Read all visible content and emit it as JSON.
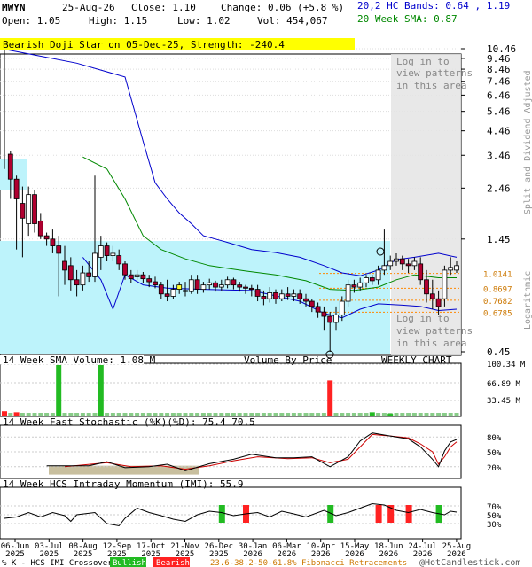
{
  "header": {
    "ticker": "MWYN",
    "date": "25-Aug-26",
    "close": "Close: 1.10",
    "change": "Change: 0.06 (+5.8 %)",
    "open": "Open: 1.05",
    "high": "High: 1.15",
    "low": "Low: 1.02",
    "vol": "Vol: 454,067",
    "hc_bands": "20,2 HC Bands: 0.64 , 1.19",
    "sma20": "20 Week SMA: 0.87"
  },
  "banner": "Bearish Doji Star on 05-Dec-25, Strength: -240.4",
  "login_text": [
    "Log in to",
    "view patterns",
    "in this area"
  ],
  "side_labels": {
    "adjusted": "Split and Dividend Adjusted",
    "log": "Logarithmic"
  },
  "chart_labels": {
    "sma_volume": "14 Week SMA Volume: 1.08 M",
    "volume_by_price": "Volume By Price",
    "weekly_chart": "WEEKLY CHART",
    "stochastic": "14 Week Fast Stochastic (%K)(%D): 75.4  70.5",
    "imi": "14 Week HCS Intraday Momentum (IMI): 55.9"
  },
  "footer": {
    "legend_prefix": "% K - HCS IMI Crossover:",
    "bullish": "Bullish",
    "bearish": "Bearish",
    "fib": "23.6-38.2-50-61.8% Fibonacci Retracements",
    "copyright": "@HotCandlestick.com"
  },
  "colors": {
    "bull": "#ffffff",
    "bear": "#b00030",
    "upper_band": "#0000cc",
    "sma": "#008800",
    "vbp": "#bdf3fb",
    "banner": "#ffff00",
    "login_bg": "#e4e4e4",
    "vol_green": "#22bb22",
    "vol_red": "#ff2222"
  },
  "chart_data": {
    "type": "candlestick",
    "scale": "logarithmic",
    "price_ticks": [
      "10.46",
      "9.46",
      "8.46",
      "7.46",
      "6.46",
      "5.46",
      "4.46",
      "3.46",
      "2.46",
      "1.45",
      "0.45"
    ],
    "fib_levels": [
      "1.0141",
      "0.8697",
      "0.7682",
      "0.6785"
    ],
    "x_labels": [
      [
        "06-Jun",
        "2025"
      ],
      [
        "03-Jul",
        "2025"
      ],
      [
        "08-Aug",
        "2025"
      ],
      [
        "12-Sep",
        "2025"
      ],
      [
        "17-Oct",
        "2025"
      ],
      [
        "21-Nov",
        "2025"
      ],
      [
        "26-Dec",
        "2025"
      ],
      [
        "30-Jan",
        "2026"
      ],
      [
        "06-Mar",
        "2026"
      ],
      [
        "10-Apr",
        "2026"
      ],
      [
        "15-May",
        "2026"
      ],
      [
        "18-Jun",
        "2026"
      ],
      [
        "24-Jul",
        "2026"
      ],
      [
        "25-Aug",
        "2026"
      ]
    ],
    "candles": [
      [
        10.5,
        10.4,
        11.0,
        3.0
      ],
      [
        3.5,
        2.7,
        3.6,
        2.2
      ],
      [
        2.7,
        2.2,
        2.8,
        1.3
      ],
      [
        2.1,
        1.8,
        2.5,
        1.2
      ],
      [
        1.7,
        2.3,
        2.5,
        1.5
      ],
      [
        2.3,
        1.7,
        2.4,
        1.55
      ],
      [
        1.75,
        1.5,
        1.9,
        1.45
      ],
      [
        1.5,
        1.45,
        1.55,
        1.35
      ],
      [
        1.45,
        1.35,
        1.6,
        1.25
      ],
      [
        1.35,
        1.25,
        1.5,
        0.8
      ],
      [
        1.15,
        1.05,
        1.35,
        0.9
      ],
      [
        1.1,
        0.95,
        1.2,
        0.85
      ],
      [
        0.95,
        0.9,
        1.05,
        0.8
      ],
      [
        0.9,
        1.02,
        1.1,
        0.85
      ],
      [
        1.02,
        0.98,
        1.15,
        0.93
      ],
      [
        0.98,
        1.25,
        2.8,
        0.93
      ],
      [
        1.2,
        1.35,
        1.5,
        1.05
      ],
      [
        1.35,
        1.22,
        1.4,
        1.15
      ],
      [
        1.22,
        1.25,
        1.35,
        1.15
      ],
      [
        1.22,
        1.12,
        1.3,
        1.05
      ],
      [
        1.12,
        1.0,
        1.15,
        0.95
      ],
      [
        1.0,
        0.96,
        1.05,
        0.92
      ],
      [
        0.98,
        1.0,
        1.05,
        0.95
      ],
      [
        1.0,
        0.96,
        1.03,
        0.92
      ],
      [
        0.96,
        0.93,
        1.0,
        0.88
      ],
      [
        0.93,
        0.9,
        0.98,
        0.87
      ],
      [
        0.9,
        0.82,
        0.93,
        0.78
      ],
      [
        0.82,
        0.8,
        0.95,
        0.76
      ],
      [
        0.8,
        0.86,
        0.9,
        0.78
      ],
      [
        0.86,
        0.9,
        0.93,
        0.82
      ],
      [
        0.85,
        0.84,
        0.93,
        0.8
      ],
      [
        0.84,
        0.95,
        1.0,
        0.82
      ],
      [
        0.95,
        0.86,
        1.0,
        0.82
      ],
      [
        0.86,
        0.9,
        0.93,
        0.83
      ],
      [
        0.9,
        0.92,
        0.96,
        0.86
      ],
      [
        0.92,
        0.88,
        0.94,
        0.84
      ],
      [
        0.88,
        0.9,
        0.95,
        0.85
      ],
      [
        0.9,
        0.95,
        0.98,
        0.87
      ],
      [
        0.95,
        0.9,
        0.97,
        0.86
      ],
      [
        0.9,
        0.88,
        0.93,
        0.84
      ],
      [
        0.88,
        0.87,
        0.9,
        0.82
      ],
      [
        0.87,
        0.86,
        0.9,
        0.8
      ],
      [
        0.86,
        0.8,
        0.9,
        0.76
      ],
      [
        0.8,
        0.78,
        0.85,
        0.73
      ],
      [
        0.78,
        0.83,
        0.88,
        0.75
      ],
      [
        0.83,
        0.78,
        0.86,
        0.74
      ],
      [
        0.78,
        0.82,
        0.86,
        0.76
      ],
      [
        0.82,
        0.8,
        0.88,
        0.77
      ],
      [
        0.8,
        0.82,
        0.86,
        0.76
      ],
      [
        0.82,
        0.78,
        0.86,
        0.74
      ],
      [
        0.78,
        0.76,
        0.82,
        0.72
      ],
      [
        0.76,
        0.72,
        0.78,
        0.68
      ],
      [
        0.72,
        0.68,
        0.75,
        0.64
      ],
      [
        0.68,
        0.65,
        0.72,
        0.56
      ],
      [
        0.65,
        0.61,
        0.68,
        0.45
      ],
      [
        0.61,
        0.66,
        0.72,
        0.56
      ],
      [
        0.66,
        0.76,
        0.8,
        0.62
      ],
      [
        0.76,
        0.9,
        0.95,
        0.72
      ],
      [
        0.9,
        0.88,
        0.95,
        0.83
      ],
      [
        0.88,
        0.92,
        0.97,
        0.85
      ],
      [
        0.92,
        0.97,
        1.0,
        0.88
      ],
      [
        0.97,
        0.94,
        1.0,
        0.9
      ],
      [
        0.95,
        1.05,
        1.1,
        0.9
      ],
      [
        1.05,
        1.1,
        1.6,
        1.0
      ],
      [
        1.1,
        1.15,
        1.22,
        1.05
      ],
      [
        1.15,
        1.18,
        1.25,
        1.1
      ],
      [
        1.18,
        1.12,
        1.22,
        1.05
      ],
      [
        1.12,
        1.1,
        1.18,
        1.02
      ],
      [
        1.1,
        1.15,
        1.2,
        1.05
      ],
      [
        1.12,
        0.95,
        1.2,
        0.9
      ],
      [
        0.95,
        0.82,
        1.05,
        0.75
      ],
      [
        0.82,
        0.78,
        0.95,
        0.7
      ],
      [
        0.78,
        0.72,
        0.85,
        0.66
      ],
      [
        0.78,
        1.05,
        1.1,
        0.72
      ],
      [
        1.05,
        1.08,
        1.2,
        1.0
      ],
      [
        1.05,
        1.1,
        1.15,
        1.02
      ]
    ],
    "upper_band": [
      [
        0,
        10.4
      ],
      [
        5,
        9.8
      ],
      [
        12,
        9.0
      ],
      [
        20,
        7.8
      ],
      [
        23,
        4.0
      ],
      [
        25,
        2.6
      ],
      [
        27,
        2.2
      ],
      [
        29,
        1.9
      ],
      [
        31,
        1.7
      ],
      [
        33,
        1.5
      ],
      [
        37,
        1.4
      ],
      [
        41,
        1.3
      ],
      [
        45,
        1.26
      ],
      [
        49,
        1.2
      ],
      [
        53,
        1.1
      ],
      [
        56,
        1.02
      ],
      [
        59,
        0.99
      ],
      [
        62,
        1.05
      ],
      [
        65,
        1.17
      ],
      [
        68,
        1.2
      ],
      [
        72,
        1.25
      ],
      [
        75,
        1.2
      ]
    ],
    "lower_band": [
      [
        13,
        1.2
      ],
      [
        16,
        0.95
      ],
      [
        18,
        0.7
      ],
      [
        20,
        1.0
      ],
      [
        23,
        0.9
      ],
      [
        27,
        0.87
      ],
      [
        33,
        0.86
      ],
      [
        41,
        0.85
      ],
      [
        49,
        0.76
      ],
      [
        53,
        0.67
      ],
      [
        56,
        0.64
      ],
      [
        59,
        0.7
      ],
      [
        62,
        0.74
      ],
      [
        66,
        0.73
      ],
      [
        69,
        0.72
      ],
      [
        72,
        0.69
      ],
      [
        75,
        0.7
      ]
    ],
    "sma_line": [
      [
        13,
        3.4
      ],
      [
        17,
        3.0
      ],
      [
        20,
        2.2
      ],
      [
        23,
        1.5
      ],
      [
        26,
        1.3
      ],
      [
        30,
        1.18
      ],
      [
        34,
        1.1
      ],
      [
        40,
        1.04
      ],
      [
        45,
        1.0
      ],
      [
        50,
        0.94
      ],
      [
        54,
        0.86
      ],
      [
        58,
        0.85
      ],
      [
        62,
        0.88
      ],
      [
        65,
        0.95
      ],
      [
        68,
        1.0
      ],
      [
        72,
        0.97
      ],
      [
        75,
        0.97
      ]
    ],
    "volume_spikes": [
      {
        "week": 0,
        "value": 10,
        "color": "red"
      },
      {
        "week": 2,
        "value": 8,
        "color": "red"
      },
      {
        "week": 9,
        "value": 100,
        "color": "green"
      },
      {
        "week": 16,
        "value": 100,
        "color": "green"
      },
      {
        "week": 54,
        "value": 70,
        "color": "red"
      },
      {
        "week": 61,
        "value": 8,
        "color": "green"
      },
      {
        "week": 64,
        "value": 5,
        "color": "green"
      }
    ],
    "volume_ticks": [
      "100.34 M",
      "66.89 M",
      "33.45 M"
    ],
    "stoch_ticks": [
      "80%",
      "50%",
      "20%"
    ],
    "stoch_k": [
      [
        7,
        22
      ],
      [
        14,
        22
      ],
      [
        17,
        30
      ],
      [
        20,
        18
      ],
      [
        24,
        20
      ],
      [
        27,
        25
      ],
      [
        30,
        12
      ],
      [
        34,
        26
      ],
      [
        38,
        35
      ],
      [
        41,
        45
      ],
      [
        45,
        38
      ],
      [
        48,
        38
      ],
      [
        51,
        40
      ],
      [
        54,
        20
      ],
      [
        57,
        40
      ],
      [
        59,
        72
      ],
      [
        61,
        88
      ],
      [
        63,
        84
      ],
      [
        65,
        80
      ],
      [
        67,
        76
      ],
      [
        69,
        60
      ],
      [
        71,
        35
      ],
      [
        72,
        20
      ],
      [
        73,
        52
      ],
      [
        74,
        70
      ],
      [
        75,
        75
      ]
    ],
    "stoch_d": [
      [
        10,
        20
      ],
      [
        17,
        28
      ],
      [
        21,
        20
      ],
      [
        26,
        22
      ],
      [
        30,
        15
      ],
      [
        34,
        22
      ],
      [
        38,
        32
      ],
      [
        42,
        40
      ],
      [
        47,
        36
      ],
      [
        51,
        38
      ],
      [
        54,
        28
      ],
      [
        57,
        35
      ],
      [
        59,
        60
      ],
      [
        61,
        85
      ],
      [
        64,
        82
      ],
      [
        67,
        78
      ],
      [
        69,
        66
      ],
      [
        71,
        50
      ],
      [
        72,
        25
      ],
      [
        73,
        40
      ],
      [
        74,
        60
      ],
      [
        75,
        70
      ]
    ],
    "imi_ticks": [
      "70%",
      "50%",
      "30%"
    ],
    "imi": [
      [
        0,
        42
      ],
      [
        2,
        45
      ],
      [
        4,
        55
      ],
      [
        6,
        45
      ],
      [
        8,
        55
      ],
      [
        10,
        48
      ],
      [
        11,
        35
      ],
      [
        12,
        50
      ],
      [
        15,
        55
      ],
      [
        17,
        30
      ],
      [
        19,
        25
      ],
      [
        20,
        42
      ],
      [
        22,
        65
      ],
      [
        24,
        55
      ],
      [
        26,
        48
      ],
      [
        28,
        40
      ],
      [
        30,
        35
      ],
      [
        32,
        50
      ],
      [
        34,
        58
      ],
      [
        36,
        55
      ],
      [
        38,
        48
      ],
      [
        40,
        52
      ],
      [
        42,
        55
      ],
      [
        44,
        45
      ],
      [
        46,
        58
      ],
      [
        48,
        52
      ],
      [
        50,
        45
      ],
      [
        53,
        60
      ],
      [
        55,
        48
      ],
      [
        57,
        55
      ],
      [
        59,
        65
      ],
      [
        61,
        75
      ],
      [
        63,
        72
      ],
      [
        65,
        60
      ],
      [
        67,
        55
      ],
      [
        69,
        62
      ],
      [
        71,
        55
      ],
      [
        73,
        50
      ],
      [
        74,
        58
      ],
      [
        75,
        56
      ]
    ],
    "imi_crossovers": [
      {
        "week": 36,
        "type": "bullish"
      },
      {
        "week": 40,
        "type": "bearish"
      },
      {
        "week": 54,
        "type": "bullish"
      },
      {
        "week": 62,
        "type": "bearish"
      },
      {
        "week": 64,
        "type": "bearish"
      },
      {
        "week": 67,
        "type": "bearish"
      },
      {
        "week": 72,
        "type": "bullish"
      }
    ]
  }
}
